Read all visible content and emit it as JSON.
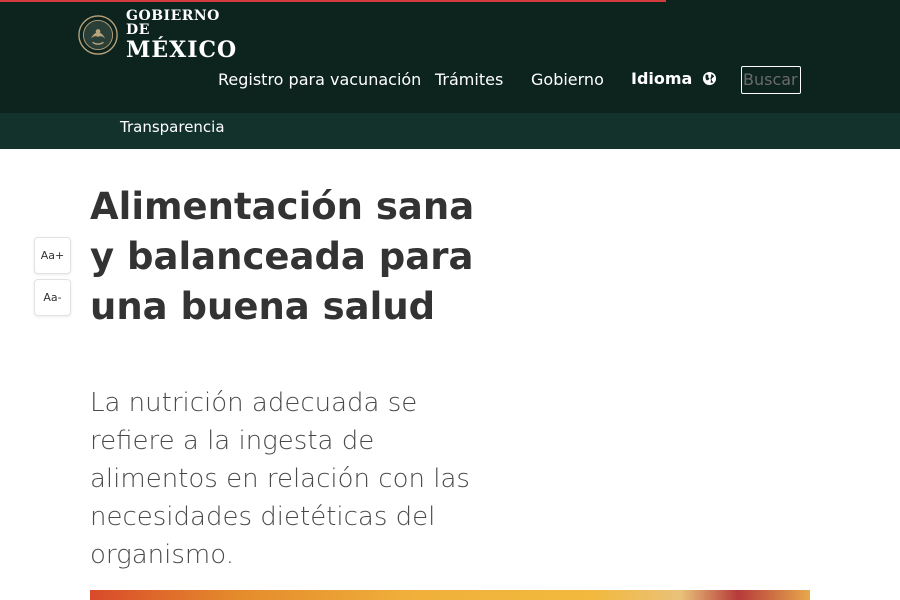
{
  "header": {
    "logo": {
      "line1": "GOBIERNO DE",
      "line2": "MÉXICO"
    },
    "nav": {
      "vacunacion": "Registro para vacunación",
      "tramites": "Trámites",
      "gobierno": "Gobierno",
      "idioma": "Idioma",
      "transparencia": "Transparencia"
    },
    "search": {
      "placeholder": "Buscar"
    }
  },
  "font_controls": {
    "increase": "Aa+",
    "decrease": "Aa-"
  },
  "article": {
    "title": "Alimentación sana y balanceada para una buena salud",
    "lead": "La nutrición adecuada se refiere a la ingesta de alimentos en relación con las necesidades dietéticas del organismo."
  },
  "colors": {
    "header_bg": "#0c231e",
    "subnav_bg": "#13322b",
    "loading_bar": "#d23c3c",
    "title_text": "#333333"
  },
  "icons": {
    "globe": "globe-icon",
    "seal": "national-seal-icon"
  }
}
